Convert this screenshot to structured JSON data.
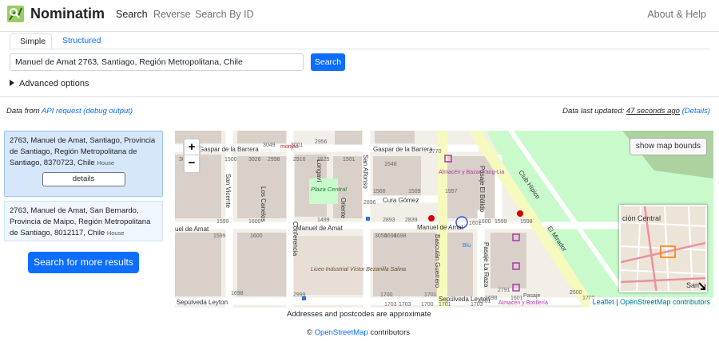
{
  "brand": "Nominatim",
  "nav": {
    "search": "Search",
    "reverse": "Reverse",
    "search_by_id": "Search By ID",
    "about": "About & Help"
  },
  "tabs": {
    "simple": "Simple",
    "structured": "Structured"
  },
  "search": {
    "value": "Manuel de Amat 2763, Santiago, Región Metropolitana, Chile",
    "button": "Search"
  },
  "advanced": "Advanced options",
  "status": {
    "data_from_prefix": "Data from",
    "api_request": "API request",
    "debug_output": "(debug output)",
    "last_updated_prefix": "Data last updated:",
    "last_updated_value": "47 seconds ago",
    "details_link": "(Details)"
  },
  "results": [
    {
      "text": "2763, Manuel de Amat, Santiago, Provincia de Santiago, Región Metropolitana de Santiago, 8370723, Chile",
      "type": "House",
      "button": "details"
    },
    {
      "text": "2763, Manuel de Amat, San Bernardo, Provincia de Maipo, Región Metropolitana de Santiago, 8012117, Chile",
      "type": "House"
    }
  ],
  "more_results": "Search for more results",
  "map": {
    "zoom_in": "+",
    "zoom_out": "−",
    "show_bounds": "show map bounds",
    "attribution_leaflet": "Leaflet",
    "attribution_sep": " | ",
    "attribution_osm": "OpenStreetMap contributors",
    "labels": {
      "gaspar_left": "Gaspar de la Barrera",
      "gaspar_right": "Gaspar de la Barrera",
      "cura_gomez": "Cura Gómez",
      "manuel_amat_1": "uel de Amat",
      "manuel_amat_2": "Manuel de Amat",
      "manuel_amat_3": "Manuel de Amat",
      "sepulveda_1": "Sepúlveda Leyton",
      "sepulveda_2": "Sepúlveda Leyton",
      "plaza_central": "Plaza Central",
      "liceo": "Liceo Industrial Víctor Bezanilla Salina",
      "almacen_1": "Almacén y Bazar Yang-Lia",
      "almacen_2": "Almacén y Botillería",
      "blu": "Blu",
      "club_hipico": "Club Hípico",
      "el_mirador": "El Mirador",
      "san_vicente": "San Vicente",
      "los_canelos": "Los Canelos",
      "longavi": "Longaví",
      "oriente": "Oriente",
      "san_alfonso": "San Alfonso",
      "conferencia": "Conferencia",
      "basculan": "Basculán Guerrero",
      "pasaje_bolido": "Pasaje El Bólido",
      "pasaje_raza": "Pasaje La Raza",
      "minimap_label": "ción Central",
      "minimap_san": "San",
      "monjas": "monjas",
      "pasaje": "Pasaje"
    },
    "house_numbers": [
      "3049",
      "3001",
      "2956",
      "3052",
      "1500",
      "3026",
      "2998",
      "2916",
      "1525",
      "1501",
      "2770",
      "1548",
      "1566",
      "1509",
      "1557",
      "2896",
      "2893",
      "2839",
      "1499",
      "1599",
      "1600",
      "1599",
      "3050",
      "1698",
      "1600",
      "1698",
      "1600",
      "1599",
      "1598",
      "1601",
      "2791",
      "1698",
      "2999",
      "1700",
      "1703",
      "1701",
      "1700",
      "1703",
      "1701",
      "1703",
      "1701",
      "2600",
      "1700",
      "1698",
      "1601"
    ]
  },
  "approx_note": "Addresses and postcodes are approximate",
  "footer": {
    "prefix": "©",
    "link": "OpenStreetMap",
    "suffix": "contributors"
  },
  "colors": {
    "accent": "#0d6efd",
    "park": "#c8facc",
    "road": "#ffffff",
    "main_road": "#f7fabf",
    "building": "#d9d0c9"
  }
}
